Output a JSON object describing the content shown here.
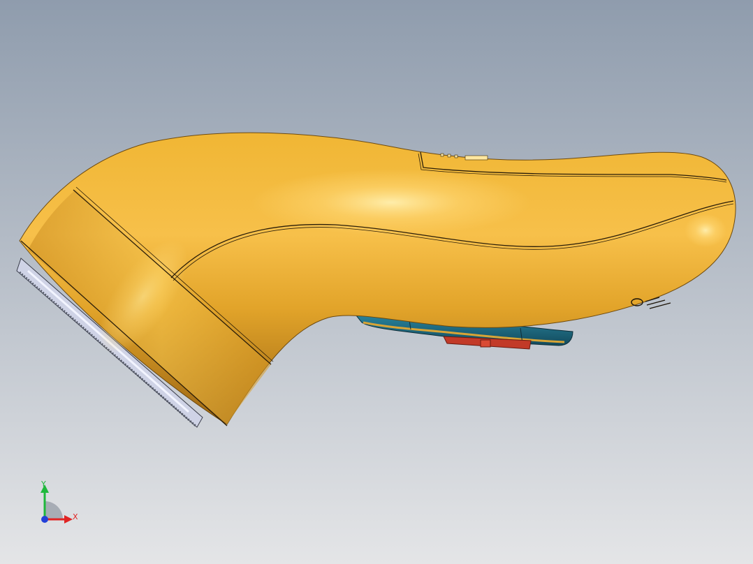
{
  "viewport": {
    "background_top": "#8f9cad",
    "background_bottom": "#e4e5e7"
  },
  "model": {
    "body_color": "#e2a42a",
    "body_highlight": "#ffd875",
    "body_shadow": "#9c6612",
    "edge_line_color": "#2a1d08",
    "trigger_color": "#1f6f86",
    "trigger_accent": "#d8a436",
    "switch_color": "#c23a28",
    "blade_color": "#d8dcf0"
  },
  "triad": {
    "y_label": "Y",
    "x_label": "X",
    "y_color": "#1fb83c",
    "x_color": "#e02424",
    "z_color": "#2340d8"
  }
}
